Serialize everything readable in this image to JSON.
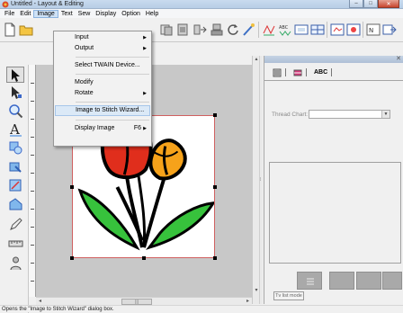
{
  "window": {
    "title": "Untitled - Layout & Editing"
  },
  "menubar": [
    "File",
    "Edit",
    "Image",
    "Text",
    "Sew",
    "Display",
    "Option",
    "Help"
  ],
  "image_menu": {
    "items": [
      {
        "label": "Input",
        "submenu": true
      },
      {
        "label": "Output",
        "submenu": true
      },
      {
        "label": "Select TWAIN Device..."
      },
      {
        "label": "Modify"
      },
      {
        "label": "Rotate",
        "submenu": true
      },
      {
        "label": "Image to Stitch Wizard..."
      },
      {
        "label": "Display Image",
        "shortcut": "F6"
      }
    ],
    "highlighted": "Image to Stitch Wizard..."
  },
  "right_panel": {
    "tabs": [
      "",
      "",
      "ABC"
    ],
    "thread_chart_label": "Thread Chart:",
    "thread_chart_value": "",
    "tv_list_button": "Tv list mode"
  },
  "status": {
    "text": "Opens the \"Image to Stitch Wizard\" dialog box."
  },
  "colors": {
    "accent": "#3366cc",
    "petal_red": "#e02e1c",
    "petal_orange": "#f6a21a",
    "leaf_green": "#37c23c"
  },
  "icons": [
    "app-icon",
    "new-file-icon",
    "open-folder-icon",
    "select-arrow-icon",
    "zoom-icon",
    "text-tool-icon",
    "stitch-icon"
  ]
}
